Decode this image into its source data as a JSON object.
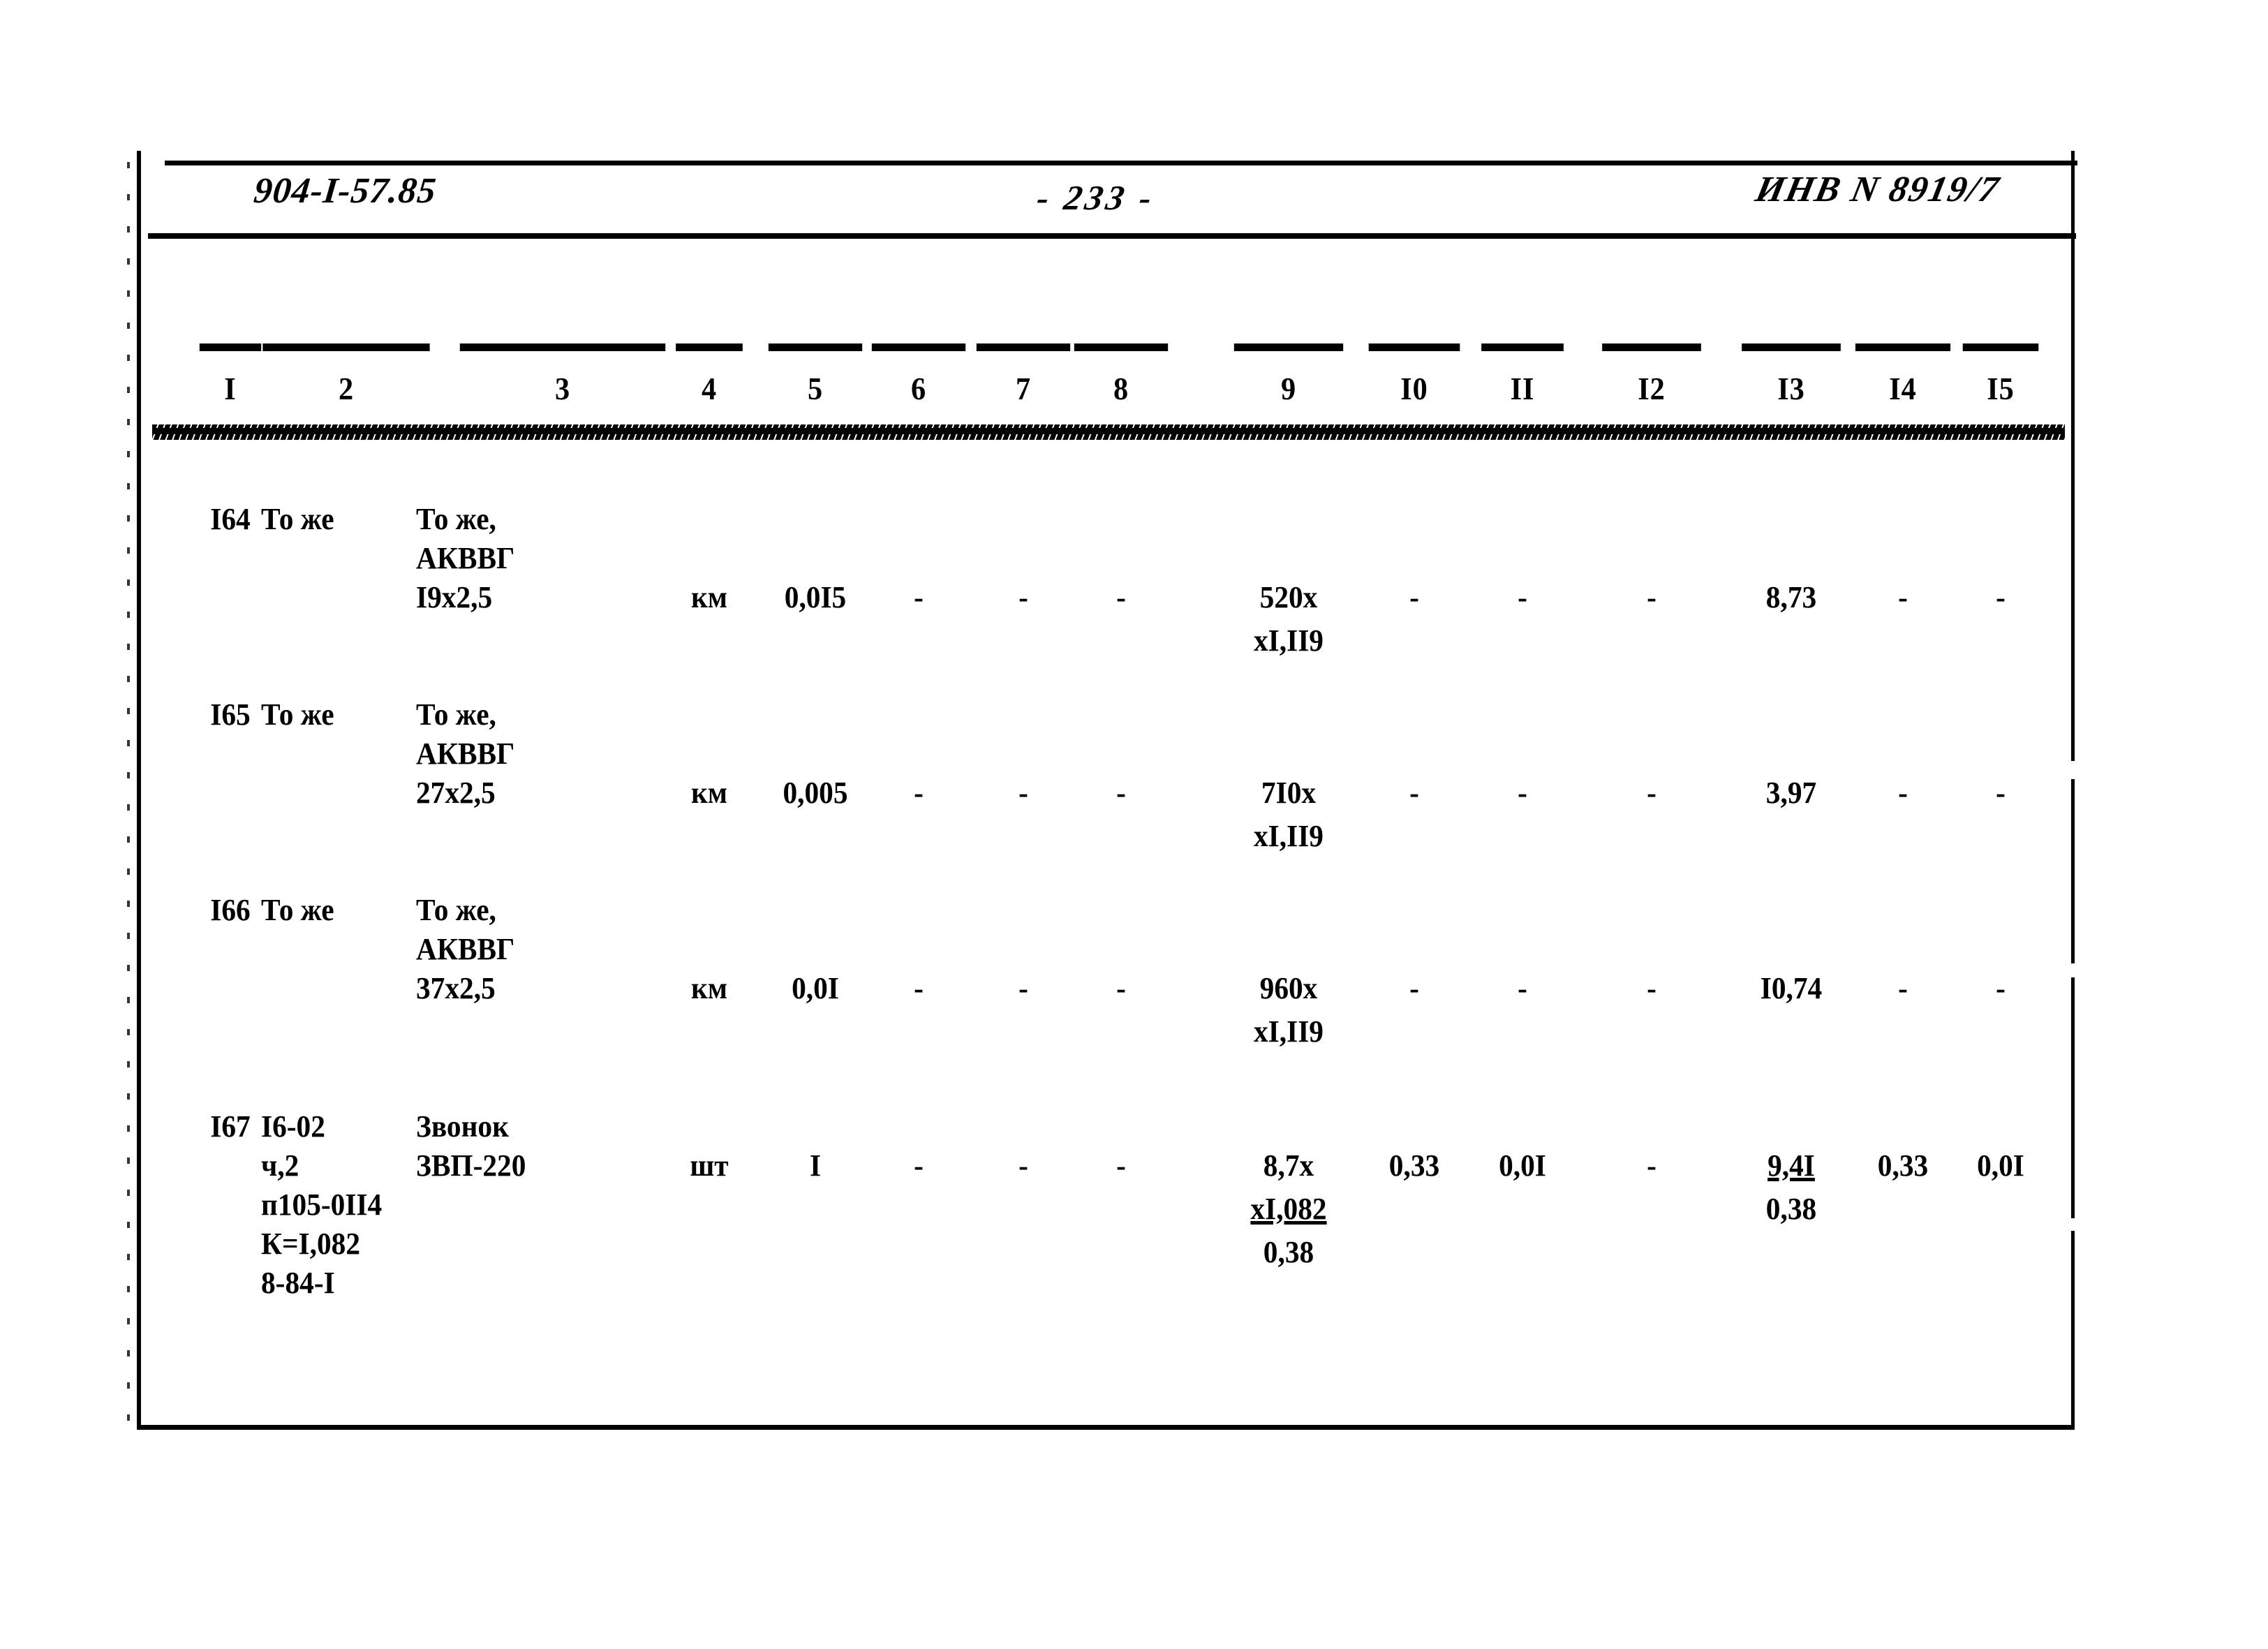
{
  "header": {
    "doc_code": "904-I-57.85",
    "page_number": "- 233 -",
    "inventory_number": "ИНВ N 8919/7"
  },
  "table": {
    "column_numbers": [
      "I",
      "2",
      "3",
      "4",
      "5",
      "6",
      "7",
      "8",
      "9",
      "I0",
      "II",
      "I2",
      "I3",
      "I4",
      "I5"
    ],
    "rows": [
      {
        "c1": "I64",
        "c2": "То же",
        "c3": "То же,\nАКВВГ\nI9х2,5",
        "c4": "км",
        "c5": "0,0I5",
        "c6": "-",
        "c7": "-",
        "c8": "-",
        "c9_top": "520х",
        "c9_mid": "хI,II9",
        "c9_bot": "",
        "c10": "-",
        "c11": "-",
        "c12": "-",
        "c13_top": "8,73",
        "c13_bot": "",
        "c14": "-",
        "c15": "-"
      },
      {
        "c1": "I65",
        "c2": "То же",
        "c3": "То же,\nАКВВГ\n27х2,5",
        "c4": "км",
        "c5": "0,005",
        "c6": "-",
        "c7": "-",
        "c8": "-",
        "c9_top": "7I0х",
        "c9_mid": "хI,II9",
        "c9_bot": "",
        "c10": "-",
        "c11": "-",
        "c12": "-",
        "c13_top": "3,97",
        "c13_bot": "",
        "c14": "-",
        "c15": "-"
      },
      {
        "c1": "I66",
        "c2": "То же",
        "c3": "То же,\nАКВВГ\n37х2,5",
        "c4": "км",
        "c5": "0,0I",
        "c6": "-",
        "c7": "-",
        "c8": "-",
        "c9_top": "960х",
        "c9_mid": "хI,II9",
        "c9_bot": "",
        "c10": "-",
        "c11": "-",
        "c12": "-",
        "c13_top": "I0,74",
        "c13_bot": "",
        "c14": "-",
        "c15": "-"
      },
      {
        "c1": "I67",
        "c2": "I6-02\nч,2\nп105-0II4\nК=I,082\n8-84-I",
        "c3": "Звонок\nЗВП-220",
        "c4": "шт",
        "c5": "I",
        "c6": "-",
        "c7": "-",
        "c8": "-",
        "c9_top": "8,7х",
        "c9_mid": "хI,082",
        "c9_bot": "0,38",
        "c10": "0,33",
        "c11": "0,0I",
        "c12": "-",
        "c13_top": "9,4I",
        "c13_bot": "0,38",
        "c14": "0,33",
        "c15": "0,0I"
      }
    ]
  }
}
